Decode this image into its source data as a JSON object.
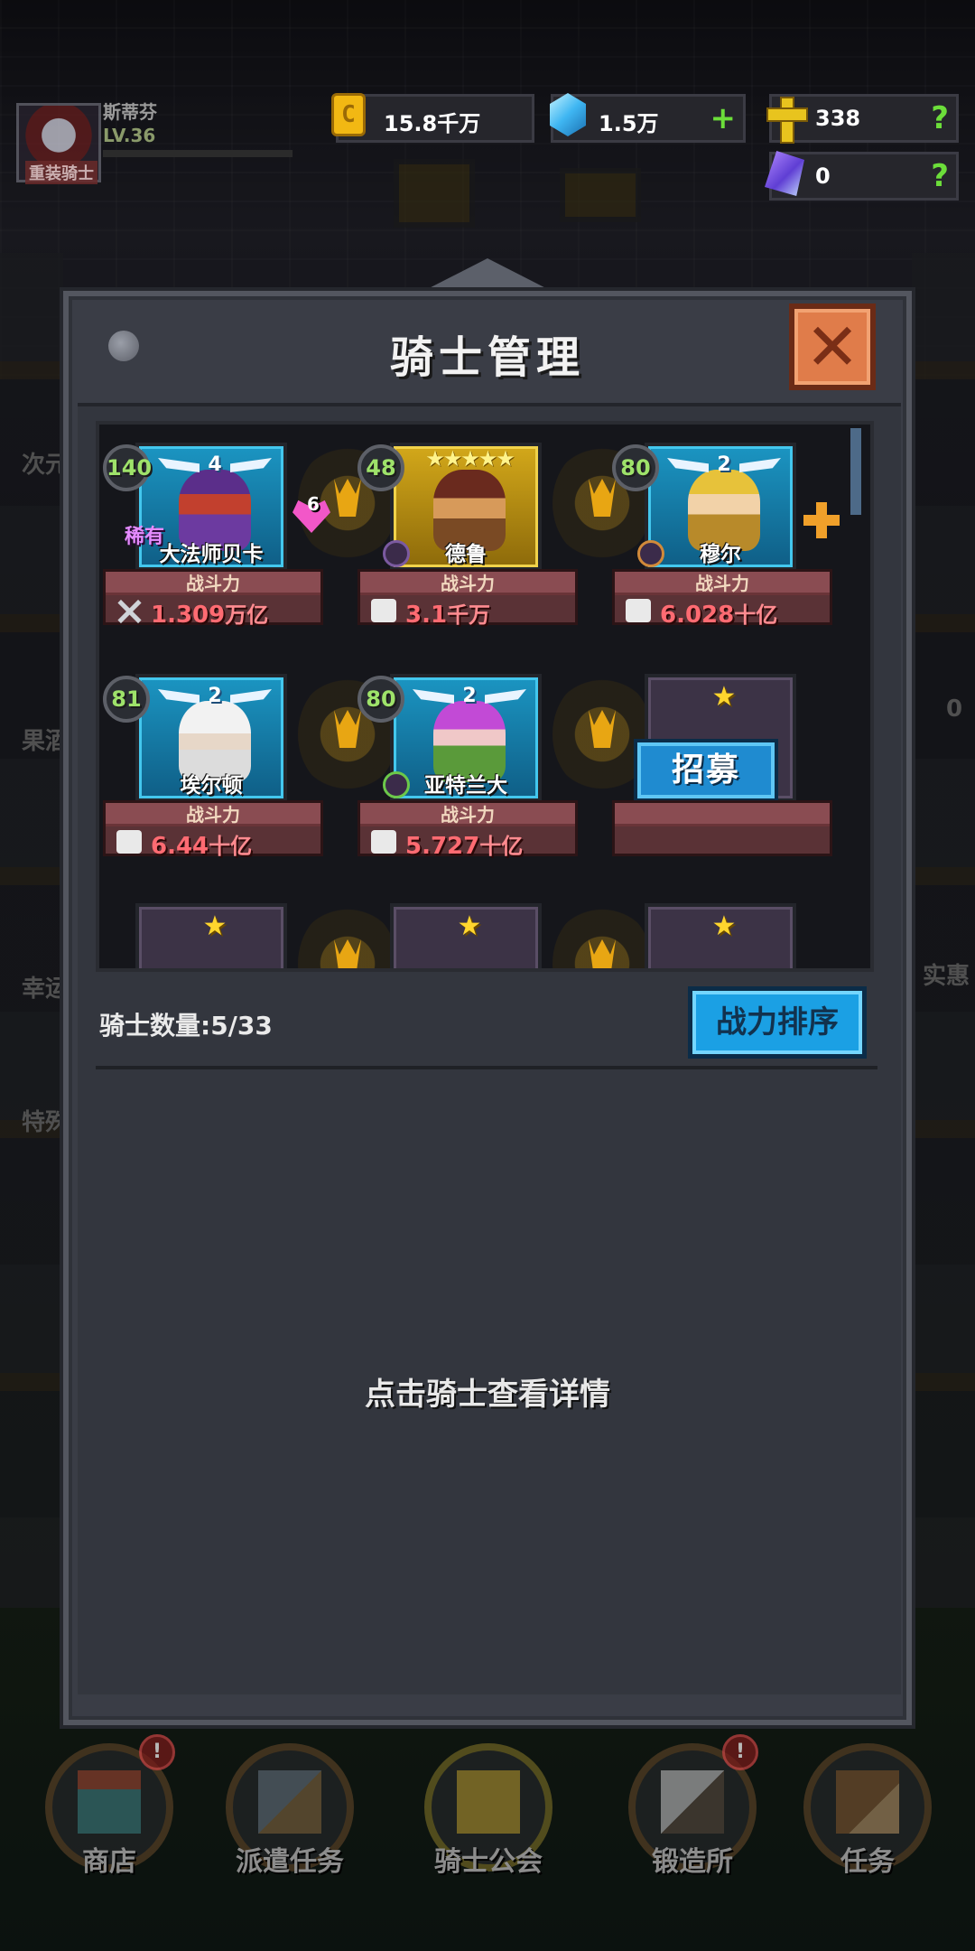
{
  "player": {
    "name": "斯蒂芬",
    "level": "LV.36",
    "title": "重装骑士"
  },
  "resources": {
    "gold": "15.8千万",
    "gems": "1.5万",
    "gems_add": "+",
    "holy": "338",
    "holy_help": "?",
    "crystal": "0",
    "crystal_help": "?"
  },
  "panel": {
    "title": "骑士管理",
    "close": "✕",
    "knight_count": "骑士数量:5/33",
    "sort_button": "战力排序",
    "hint": "点击骑士查看详情"
  },
  "knights": [
    {
      "name": "大法师贝卡",
      "level": "140",
      "stars": "4",
      "rarity": "稀有",
      "side_num": "6",
      "power_label": "战斗力",
      "power": "1.309",
      "power_unit": "万亿"
    },
    {
      "name": "德鲁",
      "level": "48",
      "stars": "★★★★★",
      "power_label": "战斗力",
      "power": "3.1",
      "power_unit": "千万"
    },
    {
      "name": "穆尔",
      "level": "80",
      "stars": "2",
      "power_label": "战斗力",
      "power": "6.028",
      "power_unit": "十亿"
    },
    {
      "name": "埃尔顿",
      "level": "81",
      "stars": "2",
      "power_label": "战斗力",
      "power": "6.44",
      "power_unit": "十亿"
    },
    {
      "name": "亚特兰大",
      "level": "80",
      "stars": "2",
      "power_label": "战斗力",
      "power": "5.727",
      "power_unit": "十亿"
    }
  ],
  "empty_slot": {
    "star": "★",
    "recruit": "招募"
  },
  "bottom_nav": [
    {
      "label": "商店",
      "badge": "!"
    },
    {
      "label": "派遣任务",
      "badge": ""
    },
    {
      "label": "骑士公会",
      "badge": ""
    },
    {
      "label": "锻造所",
      "badge": "!"
    },
    {
      "label": "任务",
      "badge": ""
    }
  ],
  "side_hints": {
    "left": [
      "次元",
      "果酒",
      "幸运",
      "特殊"
    ],
    "right": [
      "0",
      "实惠"
    ]
  }
}
